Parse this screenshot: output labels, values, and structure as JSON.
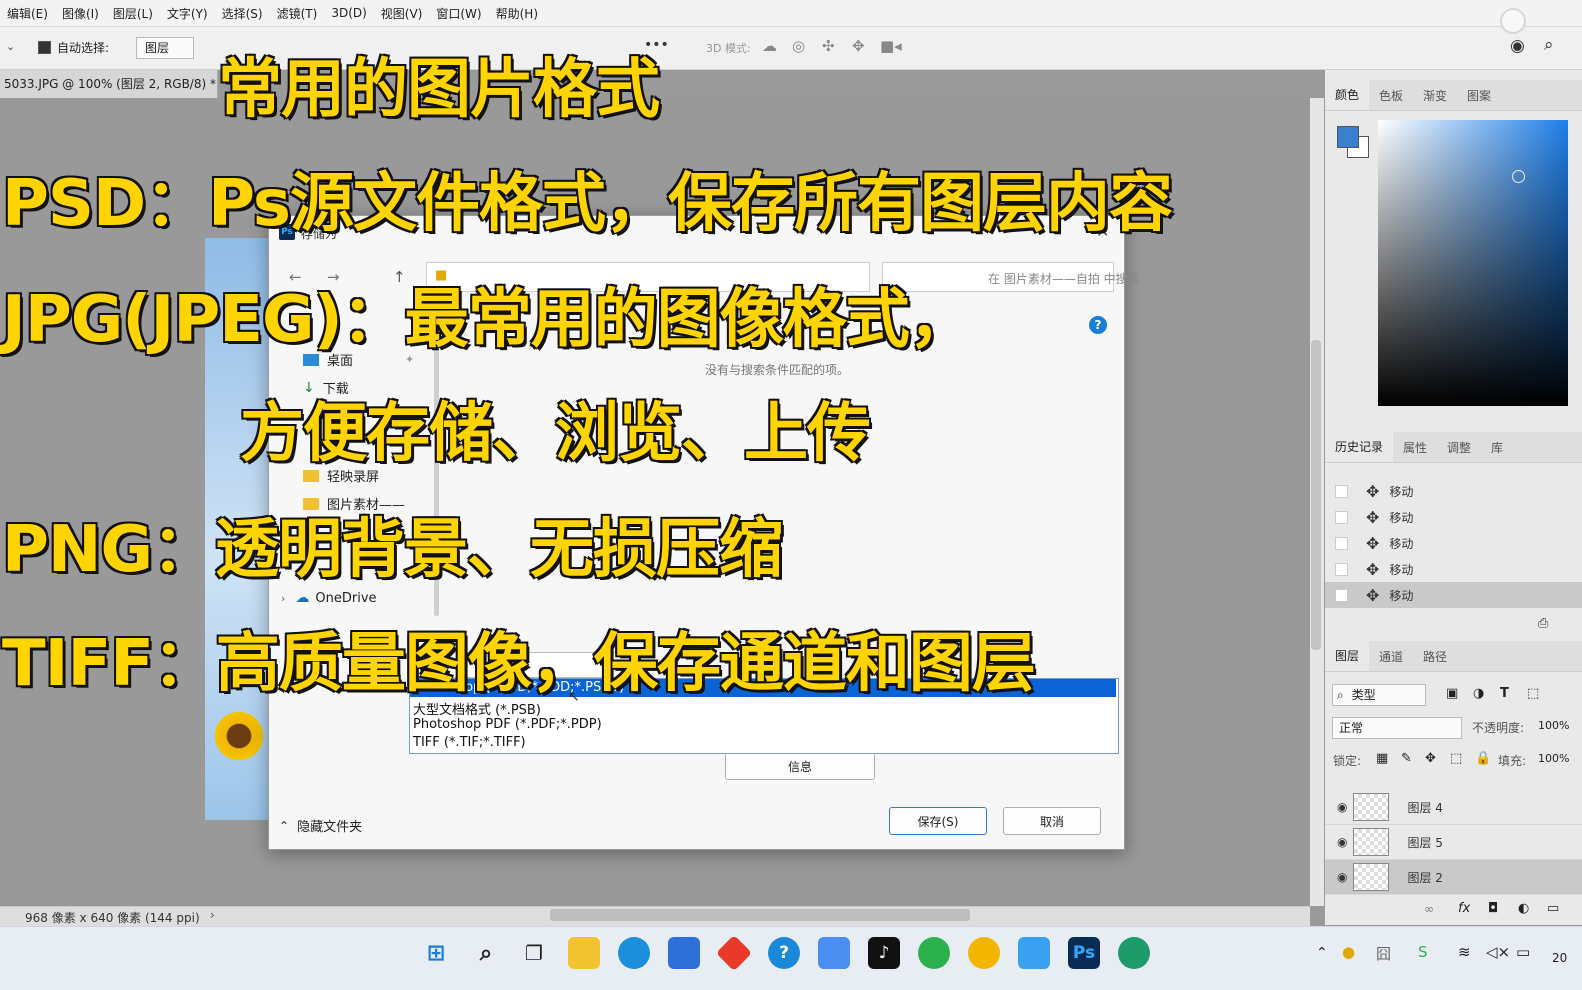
{
  "menubar": {
    "items": [
      "编辑(E)",
      "图像(I)",
      "图层(L)",
      "文字(Y)",
      "选择(S)",
      "滤镜(T)",
      "3D(D)",
      "视图(V)",
      "窗口(W)",
      "帮助(H)"
    ]
  },
  "options_bar": {
    "auto_select_label": "自动选择:",
    "auto_select_value": "图层",
    "mode_label": "3D 模式:",
    "more": "•••"
  },
  "document": {
    "tab_title": "5033.JPG @ 100% (图层 2, RGB/8) *",
    "status": "968 像素 x 640 像素 (144 ppi)"
  },
  "overlay": {
    "title": "常用的图片格式",
    "psd": "PSD：Ps源文件格式，保存所有图层内容",
    "jpg_1": "JPG(JPEG)：最常用的图像格式，",
    "jpg_2": "方便存储、浏览、上传",
    "png": "PNG：透明背景、无损压缩",
    "tiff": "TIFF：高质量图像，保存通道和图层"
  },
  "dialog": {
    "title": "存储为",
    "search_placeholder": "在 图片素材——自拍 中搜索",
    "nav": [
      "桌面",
      "下载",
      "轻映录屏",
      "图片素材——",
      "OneDrive"
    ],
    "empty_message": "没有与搜索条件匹配的项。",
    "dropdown_options": [
      "Photoshop (*.PSD;*.PDD;*.PSDT)",
      "大型文档格式 (*.PSB)",
      "Photoshop PDF (*.PDF;*.PDP)",
      "TIFF (*.TIF;*.TIFF)"
    ],
    "info_button": "信息",
    "hide_folders": "隐藏文件夹",
    "save_button": "保存(S)",
    "cancel_button": "取消"
  },
  "panels": {
    "color_tabs": [
      "颜色",
      "色板",
      "渐变",
      "图案"
    ],
    "history_tabs": [
      "历史记录",
      "属性",
      "调整",
      "库"
    ],
    "history_items": [
      "移动",
      "移动",
      "移动",
      "移动",
      "移动"
    ],
    "layer_tabs": [
      "图层",
      "通道",
      "路径"
    ],
    "layer_filter": "类型",
    "blend_mode": "正常",
    "opacity_label": "不透明度:",
    "opacity_value": "100%",
    "lock_label": "锁定:",
    "fill_label": "填充:",
    "fill_value": "100%",
    "layers": [
      "图层 4",
      "图层 5",
      "图层 2"
    ]
  },
  "taskbar": {
    "clock": "20"
  },
  "colors": {
    "overlay_text": "#ffd400",
    "foreground": "#3a7fd0",
    "selected": "#0a64d6"
  }
}
